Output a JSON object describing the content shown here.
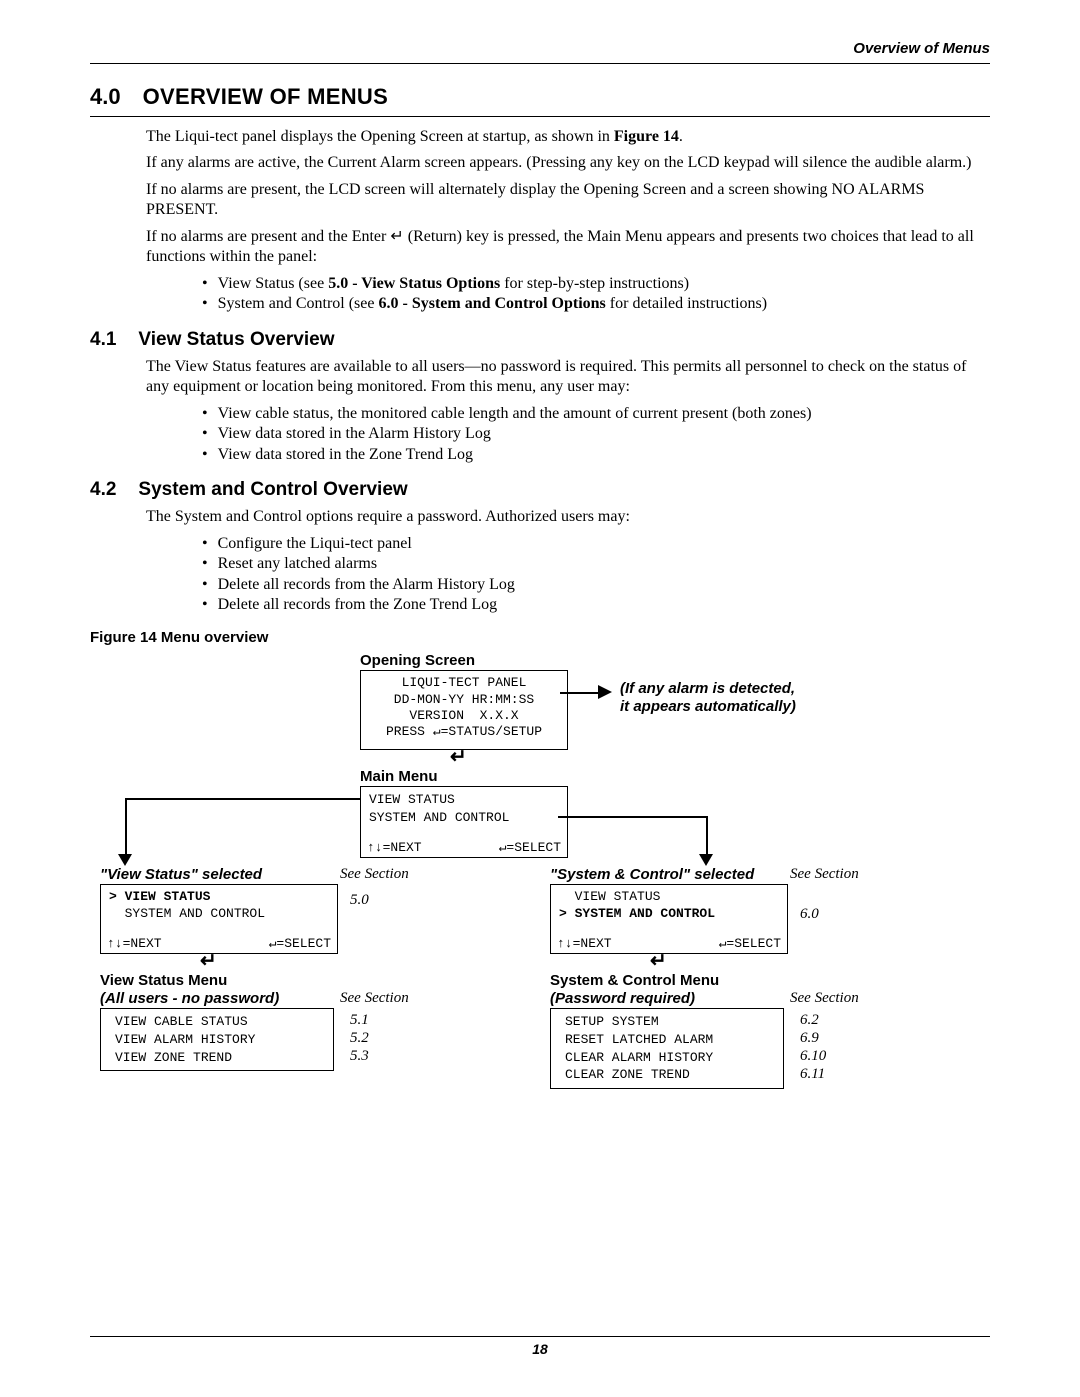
{
  "header": {
    "running": "Overview of Menus"
  },
  "section": {
    "num": "4.0",
    "title": "OVERVIEW OF MENUS",
    "p1_a": "The Liqui-tect panel displays the Opening Screen at startup, as shown in ",
    "p1_b": "Figure 14",
    "p1_c": ".",
    "p2": "If any alarms are active, the Current Alarm screen appears. (Pressing any key on the LCD keypad will silence the audible alarm.)",
    "p3": "If no alarms are present, the LCD screen will alternately display the Opening Screen and a screen showing NO ALARMS PRESENT.",
    "p4": "If no alarms are present and the Enter ↵ (Return) key is pressed, the Main Menu appears and presents two choices that lead to all functions within the panel:",
    "b1_a": "View Status (see ",
    "b1_b": "5.0 - View Status Options",
    "b1_c": " for step-by-step instructions)",
    "b2_a": "System and Control (see ",
    "b2_b": "6.0 - System and Control Options",
    "b2_c": " for detailed instructions)"
  },
  "s41": {
    "num": "4.1",
    "title": "View Status Overview",
    "p": "The View Status features are available to all users—no password is required. This permits all personnel to check on the status of any equipment or location being monitored. From this menu, any user may:",
    "items": [
      "View cable status, the monitored cable length and the amount of current present (both zones)",
      "View data stored in the Alarm History Log",
      "View data stored in the Zone Trend Log"
    ]
  },
  "s42": {
    "num": "4.2",
    "title": "System and Control Overview",
    "p": "The System and Control options require a password. Authorized users may:",
    "items": [
      "Configure the Liqui-tect panel",
      "Reset any latched alarms",
      "Delete all records from the Alarm History Log",
      "Delete all records from the Zone Trend Log"
    ]
  },
  "fig": {
    "caption": "Figure 14  Menu overview",
    "opening_label": "Opening Screen",
    "opening_lines": "LIQUI-TECT PANEL\nDD-MON-YY HR:MM:SS\nVERSION  X.X.X\nPRESS ↵=STATUS/SETUP",
    "alarm_note1": "(If any alarm is detected,",
    "alarm_note2": "it appears automatically)",
    "main_label": "Main Menu",
    "main_lines": "VIEW STATUS\nSYSTEM AND CONTROL",
    "nav_next": "↑↓=NEXT",
    "nav_select": "↵=SELECT",
    "vs_sel_label": "\"View Status\" selected",
    "sc_sel_label": "\"System & Control\" selected",
    "see_section": "See Section",
    "vs_sel_lines": "> VIEW STATUS\n  SYSTEM AND CONTROL",
    "vs_sel_sec": "5.0",
    "sc_sel_lines": "  VIEW STATUS\n> SYSTEM AND CONTROL",
    "sc_sel_sec": "6.0",
    "vs_menu_label": "View Status Menu",
    "vs_menu_sub": "(All users - no password)",
    "vs_menu_items": [
      {
        "t": "VIEW CABLE STATUS",
        "s": "5.1"
      },
      {
        "t": "VIEW ALARM HISTORY",
        "s": "5.2"
      },
      {
        "t": "VIEW ZONE TREND",
        "s": "5.3"
      }
    ],
    "sc_menu_label": "System & Control Menu",
    "sc_menu_sub": "(Password required)",
    "sc_menu_items": [
      {
        "t": "SETUP SYSTEM",
        "s": "6.2"
      },
      {
        "t": "RESET LATCHED ALARM",
        "s": "6.9"
      },
      {
        "t": "CLEAR ALARM HISTORY",
        "s": "6.10"
      },
      {
        "t": "CLEAR ZONE TREND",
        "s": "6.11"
      }
    ]
  },
  "footer": {
    "page": "18"
  }
}
